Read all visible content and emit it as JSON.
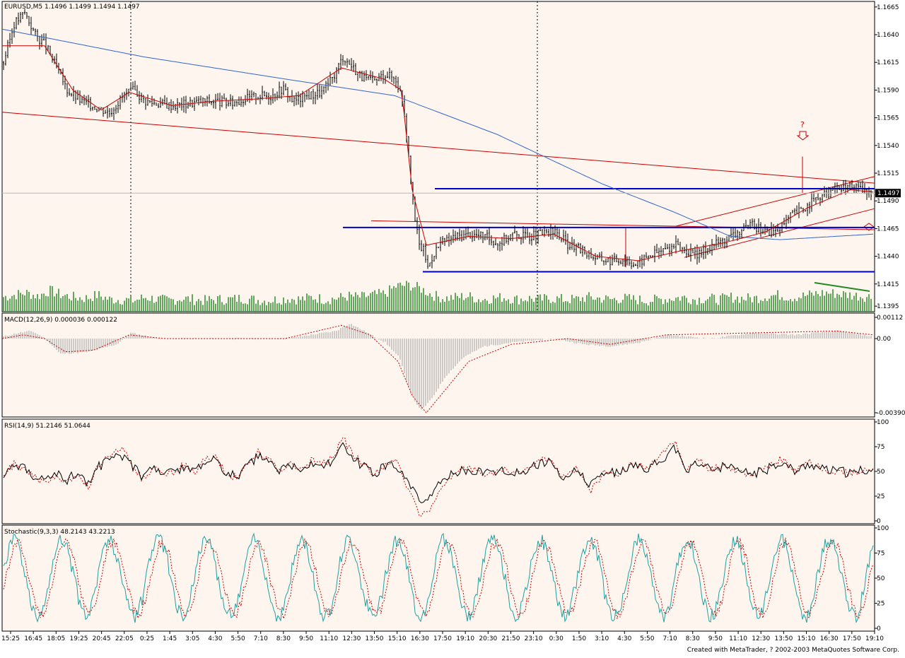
{
  "colors": {
    "background": "#fdf5ee",
    "candle": "#000000",
    "ma_red": "#cc0000",
    "ma_blue": "#3366cc",
    "hline_blue": "#0000cc",
    "trend_red": "#cc0000",
    "volume": "#2e8b2e",
    "volume_trend": "#228b22",
    "macd_hist": "#a0a0a0",
    "signal_red": "#cc0000",
    "rsi_main": "#000000",
    "stoch_main": "#20a0a0",
    "current_price_box": "#000000"
  },
  "footer": "Created with MetaTrader, ? 2002-2003 MetaQuotes Software Corp.",
  "chart_data": [
    {
      "panel": "price",
      "type": "candlestick",
      "title": "EURUSD,M5  1.1496 1.1499 1.1494 1.1497",
      "current_price": "1.1497",
      "ylim": [
        1.139,
        1.167
      ],
      "yticks": [
        "1.1665",
        "1.1640",
        "1.1615",
        "1.1590",
        "1.1565",
        "1.1540",
        "1.1515",
        "1.1490",
        "1.1465",
        "1.1440",
        "1.1415",
        "1.1395"
      ],
      "xticks": [
        "15:25",
        "16:45",
        "18:05",
        "19:25",
        "20:45",
        "22:05",
        "0:25",
        "1:45",
        "3:05",
        "4:30",
        "5:50",
        "7:10",
        "8:30",
        "9:50",
        "11:10",
        "12:30",
        "13:50",
        "15:10",
        "16:30",
        "17:50",
        "19:10",
        "20:30",
        "21:50",
        "23:10",
        "0:30",
        "1:50",
        "3:10",
        "4:30",
        "5:50",
        "7:10",
        "8:30",
        "9:50",
        "11:10",
        "12:30",
        "13:50",
        "15:10",
        "16:30",
        "17:50",
        "19:10"
      ],
      "price_path": [
        [
          0,
          1.1615
        ],
        [
          15,
          1.165
        ],
        [
          30,
          1.166
        ],
        [
          45,
          1.164
        ],
        [
          60,
          1.163
        ],
        [
          75,
          1.161
        ],
        [
          90,
          1.159
        ],
        [
          110,
          1.158
        ],
        [
          130,
          1.1575
        ],
        [
          150,
          1.157
        ],
        [
          170,
          1.1585
        ],
        [
          185,
          1.159
        ],
        [
          200,
          1.158
        ],
        [
          220,
          1.1578
        ],
        [
          240,
          1.1576
        ],
        [
          260,
          1.1578
        ],
        [
          280,
          1.158
        ],
        [
          300,
          1.158
        ],
        [
          320,
          1.1578
        ],
        [
          340,
          1.1582
        ],
        [
          360,
          1.1585
        ],
        [
          380,
          1.1585
        ],
        [
          395,
          1.1592
        ],
        [
          410,
          1.158
        ],
        [
          430,
          1.1585
        ],
        [
          450,
          1.1588
        ],
        [
          465,
          1.16
        ],
        [
          480,
          1.162
        ],
        [
          495,
          1.161
        ],
        [
          510,
          1.16
        ],
        [
          525,
          1.1598
        ],
        [
          540,
          1.1605
        ],
        [
          555,
          1.16
        ],
        [
          565,
          1.158
        ],
        [
          572,
          1.154
        ],
        [
          580,
          1.148
        ],
        [
          588,
          1.145
        ],
        [
          595,
          1.1445
        ],
        [
          600,
          1.143
        ],
        [
          610,
          1.1445
        ],
        [
          620,
          1.1452
        ],
        [
          640,
          1.1458
        ],
        [
          660,
          1.146
        ],
        [
          680,
          1.1458
        ],
        [
          700,
          1.1452
        ],
        [
          720,
          1.146
        ],
        [
          740,
          1.1458
        ],
        [
          760,
          1.146
        ],
        [
          780,
          1.1462
        ],
        [
          800,
          1.145
        ],
        [
          820,
          1.1445
        ],
        [
          840,
          1.1438
        ],
        [
          860,
          1.1436
        ],
        [
          880,
          1.1438
        ],
        [
          895,
          1.1432
        ],
        [
          910,
          1.144
        ],
        [
          930,
          1.1445
        ],
        [
          950,
          1.145
        ],
        [
          965,
          1.1445
        ],
        [
          980,
          1.144
        ],
        [
          1000,
          1.145
        ],
        [
          1020,
          1.1455
        ],
        [
          1040,
          1.1462
        ],
        [
          1060,
          1.1468
        ],
        [
          1080,
          1.1462
        ],
        [
          1100,
          1.1465
        ],
        [
          1115,
          1.1478
        ],
        [
          1130,
          1.1482
        ],
        [
          1145,
          1.149
        ],
        [
          1160,
          1.1495
        ],
        [
          1175,
          1.15
        ],
        [
          1190,
          1.1502
        ],
        [
          1200,
          1.1505
        ],
        [
          1210,
          1.15
        ],
        [
          1222,
          1.1497
        ],
        [
          1232,
          1.1497
        ]
      ],
      "ma_fast": [
        [
          0,
          1.163
        ],
        [
          60,
          1.163
        ],
        [
          100,
          1.159
        ],
        [
          140,
          1.1572
        ],
        [
          180,
          1.1588
        ],
        [
          240,
          1.1576
        ],
        [
          300,
          1.158
        ],
        [
          360,
          1.1582
        ],
        [
          420,
          1.1585
        ],
        [
          480,
          1.161
        ],
        [
          540,
          1.16
        ],
        [
          565,
          1.159
        ],
        [
          580,
          1.15
        ],
        [
          600,
          1.145
        ],
        [
          660,
          1.1458
        ],
        [
          720,
          1.1456
        ],
        [
          780,
          1.146
        ],
        [
          840,
          1.144
        ],
        [
          900,
          1.1436
        ],
        [
          960,
          1.1445
        ],
        [
          1020,
          1.1452
        ],
        [
          1080,
          1.1462
        ],
        [
          1140,
          1.1484
        ],
        [
          1200,
          1.15
        ],
        [
          1232,
          1.1498
        ]
      ],
      "ma_slow": [
        [
          0,
          1.1645
        ],
        [
          200,
          1.162
        ],
        [
          400,
          1.16
        ],
        [
          555,
          1.1585
        ],
        [
          700,
          1.155
        ],
        [
          850,
          1.1505
        ],
        [
          950,
          1.148
        ],
        [
          1030,
          1.1458
        ],
        [
          1100,
          1.1455
        ],
        [
          1232,
          1.146
        ]
      ],
      "horizontal_lines": [
        1.1501,
        1.1466,
        1.1426
      ],
      "volume_relative": [
        0.4,
        0.5,
        0.6,
        0.45,
        0.7,
        0.5,
        0.4,
        0.35,
        0.5,
        0.3,
        0.3,
        0.25,
        0.4,
        0.3,
        0.25,
        0.35,
        0.3,
        0.25,
        0.3,
        0.3,
        0.35,
        0.3,
        0.25,
        0.3,
        0.35,
        0.3,
        0.4,
        0.3,
        0.35,
        0.45,
        0.4,
        0.5,
        0.55,
        0.9,
        0.95,
        0.8,
        0.5,
        0.35,
        0.4,
        0.45,
        0.3,
        0.35,
        0.4,
        0.3,
        0.35,
        0.3,
        0.35,
        0.3,
        0.3,
        0.4,
        0.35,
        0.3,
        0.35,
        0.3,
        0.25,
        0.3,
        0.35,
        0.4,
        0.3,
        0.35,
        0.3,
        0.4,
        0.35,
        0.35,
        0.45,
        0.5,
        0.4,
        0.45,
        0.55,
        0.6,
        0.55,
        0.5,
        0.45,
        0.4
      ]
    },
    {
      "panel": "macd",
      "type": "bar",
      "title": "MACD(12,26,9)  0.000036  0.000122",
      "ylim": [
        -0.0039,
        0.00112
      ],
      "yticks": [
        "0.00112",
        "0.00",
        "-0.00390"
      ],
      "histogram": [
        [
          0,
          0.0001
        ],
        [
          20,
          0.0003
        ],
        [
          40,
          0.0004
        ],
        [
          60,
          0.0
        ],
        [
          80,
          -0.0008
        ],
        [
          120,
          -0.0007
        ],
        [
          160,
          -0.0003
        ],
        [
          180,
          0.0003
        ],
        [
          220,
          0.0
        ],
        [
          300,
          0.0
        ],
        [
          400,
          0.0
        ],
        [
          470,
          0.0004
        ],
        [
          490,
          0.0008
        ],
        [
          510,
          0.0004
        ],
        [
          540,
          -0.0002
        ],
        [
          560,
          -0.001
        ],
        [
          575,
          -0.0028
        ],
        [
          590,
          -0.0038
        ],
        [
          605,
          -0.0032
        ],
        [
          625,
          -0.002
        ],
        [
          650,
          -0.001
        ],
        [
          680,
          -0.0004
        ],
        [
          720,
          -0.0002
        ],
        [
          780,
          0.0
        ],
        [
          820,
          -0.0003
        ],
        [
          860,
          -0.0004
        ],
        [
          900,
          -0.0002
        ],
        [
          940,
          0.0002
        ],
        [
          1000,
          0.0
        ],
        [
          1060,
          0.0003
        ],
        [
          1120,
          0.0002
        ],
        [
          1180,
          0.0004
        ],
        [
          1232,
          0.0001
        ]
      ],
      "signal": [
        [
          0,
          0.0
        ],
        [
          30,
          0.0002
        ],
        [
          60,
          0.0
        ],
        [
          90,
          -0.0007
        ],
        [
          130,
          -0.0006
        ],
        [
          180,
          0.0002
        ],
        [
          230,
          0.0
        ],
        [
          400,
          0.0
        ],
        [
          480,
          0.0007
        ],
        [
          520,
          0.0002
        ],
        [
          560,
          -0.0012
        ],
        [
          580,
          -0.003
        ],
        [
          600,
          -0.0039
        ],
        [
          620,
          -0.003
        ],
        [
          660,
          -0.0012
        ],
        [
          720,
          -0.0003
        ],
        [
          800,
          0.0
        ],
        [
          860,
          -0.0003
        ],
        [
          940,
          0.0002
        ],
        [
          1060,
          0.0003
        ],
        [
          1180,
          0.0004
        ],
        [
          1232,
          0.0002
        ]
      ]
    },
    {
      "panel": "rsi",
      "type": "line",
      "title": "RSI(14,9)  51.2146  51.0644",
      "ylim": [
        0,
        100
      ],
      "yticks": [
        "100",
        "75",
        "50",
        "25",
        "0"
      ],
      "series": [
        [
          0,
          48
        ],
        [
          15,
          55
        ],
        [
          30,
          52
        ],
        [
          45,
          45
        ],
        [
          60,
          40
        ],
        [
          75,
          48
        ],
        [
          90,
          42
        ],
        [
          105,
          50
        ],
        [
          120,
          38
        ],
        [
          135,
          55
        ],
        [
          150,
          62
        ],
        [
          165,
          68
        ],
        [
          180,
          58
        ],
        [
          195,
          45
        ],
        [
          210,
          52
        ],
        [
          225,
          50
        ],
        [
          240,
          48
        ],
        [
          255,
          55
        ],
        [
          270,
          50
        ],
        [
          285,
          58
        ],
        [
          300,
          62
        ],
        [
          315,
          48
        ],
        [
          330,
          45
        ],
        [
          345,
          55
        ],
        [
          360,
          65
        ],
        [
          375,
          60
        ],
        [
          390,
          50
        ],
        [
          405,
          55
        ],
        [
          420,
          52
        ],
        [
          435,
          58
        ],
        [
          450,
          55
        ],
        [
          465,
          60
        ],
        [
          480,
          75
        ],
        [
          495,
          62
        ],
        [
          510,
          55
        ],
        [
          525,
          48
        ],
        [
          540,
          55
        ],
        [
          555,
          58
        ],
        [
          565,
          45
        ],
        [
          580,
          30
        ],
        [
          590,
          15
        ],
        [
          600,
          20
        ],
        [
          615,
          35
        ],
        [
          630,
          45
        ],
        [
          650,
          52
        ],
        [
          670,
          50
        ],
        [
          690,
          48
        ],
        [
          710,
          52
        ],
        [
          730,
          48
        ],
        [
          750,
          55
        ],
        [
          770,
          60
        ],
        [
          790,
          45
        ],
        [
          810,
          52
        ],
        [
          830,
          35
        ],
        [
          850,
          50
        ],
        [
          870,
          48
        ],
        [
          890,
          55
        ],
        [
          910,
          52
        ],
        [
          930,
          62
        ],
        [
          950,
          75
        ],
        [
          965,
          48
        ],
        [
          980,
          60
        ],
        [
          1000,
          52
        ],
        [
          1020,
          55
        ],
        [
          1040,
          50
        ],
        [
          1060,
          48
        ],
        [
          1080,
          52
        ],
        [
          1100,
          60
        ],
        [
          1120,
          50
        ],
        [
          1140,
          58
        ],
        [
          1160,
          52
        ],
        [
          1180,
          50
        ],
        [
          1200,
          48
        ],
        [
          1215,
          52
        ],
        [
          1232,
          51
        ]
      ]
    },
    {
      "panel": "stochastic",
      "type": "line",
      "title": "Stochastic(9,3,3)  48.2143  43.2213",
      "ylim": [
        0,
        100
      ],
      "yticks": [
        "100",
        "75",
        "50",
        "25",
        "0"
      ],
      "period_px": 34
    }
  ]
}
